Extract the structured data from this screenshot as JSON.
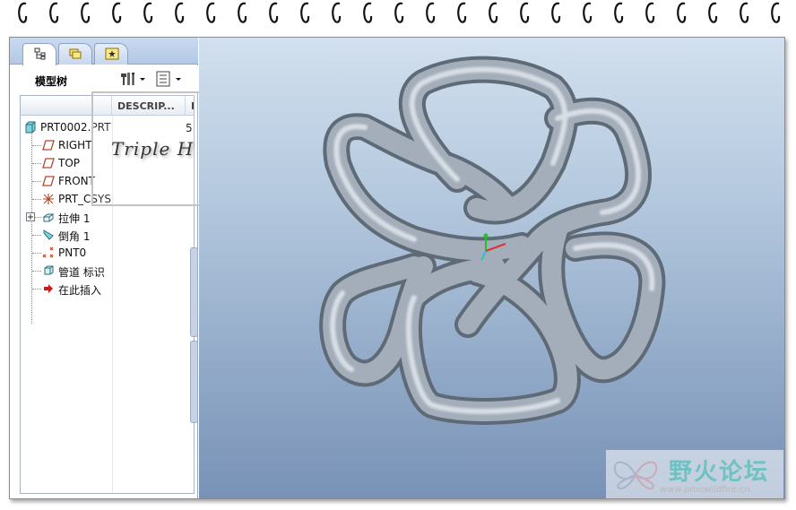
{
  "panel": {
    "title": "模型树",
    "tabs": [
      {
        "icon": "model-tree-icon"
      },
      {
        "icon": "folder-browser-icon"
      },
      {
        "icon": "favorites-icon"
      }
    ]
  },
  "tree": {
    "columns": [
      "DESCRIP...",
      "F"
    ],
    "root": {
      "label": "PRT0002.PRT",
      "value": "5"
    },
    "items": [
      {
        "label": "RIGHT",
        "icon": "datum-plane-icon"
      },
      {
        "label": "TOP",
        "icon": "datum-plane-icon"
      },
      {
        "label": "FRONT",
        "icon": "datum-plane-icon"
      },
      {
        "label": "PRT_CSYS_DEF",
        "icon": "coordinate-system-icon"
      },
      {
        "label": "拉伸 1",
        "icon": "extrude-icon"
      },
      {
        "label": "倒角 1",
        "icon": "chamfer-icon"
      },
      {
        "label": "PNT0",
        "icon": "datum-point-icon"
      },
      {
        "label": "管道 标识",
        "icon": "pipe-icon"
      },
      {
        "label": "在此插入",
        "icon": "insert-here-icon"
      }
    ]
  },
  "signature": "Triple H",
  "watermark": {
    "title": "野火论坛",
    "url": "www.proewildfire.cn"
  },
  "colors": {
    "tube": "#8a96a3",
    "viewport_top": "#d2e0ee",
    "viewport_bottom": "#7892b6",
    "logo": "#6ec3c2"
  }
}
